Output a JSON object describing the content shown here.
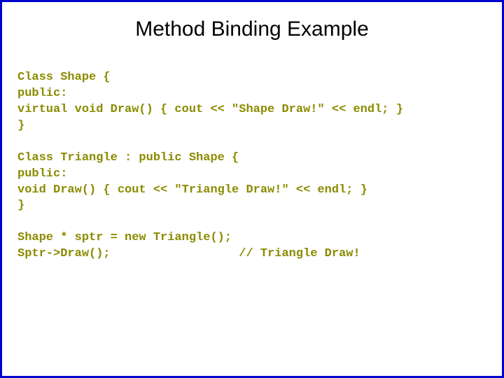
{
  "title": "Method Binding Example",
  "code": {
    "line1": "Class Shape {",
    "line2": "public:",
    "line3": "virtual void Draw() { cout << \"Shape Draw!\" << endl; }",
    "line4": "}",
    "line5": "",
    "line6": "Class Triangle : public Shape {",
    "line7": "public:",
    "line8": "void Draw() { cout << \"Triangle Draw!\" << endl; }",
    "line9": "}",
    "line10": "",
    "line11": "Shape * sptr = new Triangle();",
    "line12": "Sptr->Draw();                  // Triangle Draw!"
  }
}
